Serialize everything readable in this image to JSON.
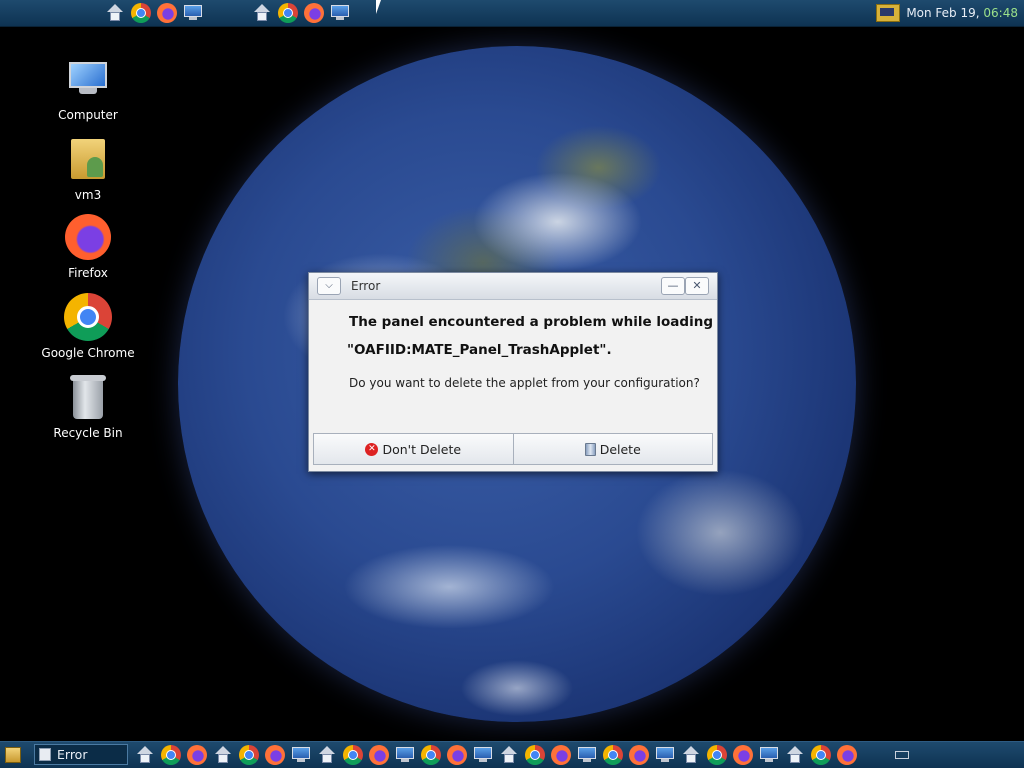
{
  "top_panel": {
    "launchers": [
      "home-icon",
      "chrome-icon",
      "firefox-icon",
      "monitor-icon",
      "home-icon",
      "chrome-icon",
      "firefox-icon",
      "monitor-icon"
    ],
    "clock": {
      "date": "Mon Feb 19,",
      "time": "06:48"
    }
  },
  "desktop": {
    "icons": [
      {
        "label": "Computer",
        "icon": "computer-icon"
      },
      {
        "label": "vm3",
        "icon": "home-folder-icon"
      },
      {
        "label": "Firefox",
        "icon": "firefox-icon"
      },
      {
        "label": "Google Chrome",
        "icon": "chrome-icon"
      },
      {
        "label": "Recycle Bin",
        "icon": "recycle-bin-icon"
      }
    ]
  },
  "dialog": {
    "title": "Error",
    "minimize_glyph": "—",
    "close_glyph": "✕",
    "heading": "The panel encountered a problem while loading",
    "applet": "\"OAFIID:MATE_Panel_TrashApplet\".",
    "question": "Do you want to delete the applet from your configuration?",
    "dont_delete_label": "Don't Delete",
    "delete_label": "Delete"
  },
  "bottom_panel": {
    "task_label": "Error",
    "launcher_pattern": [
      "home-icon",
      "chrome-icon",
      "firefox-icon",
      "home-icon",
      "chrome-icon",
      "firefox-icon",
      "monitor-icon",
      "home-icon",
      "chrome-icon",
      "firefox-icon",
      "monitor-icon",
      "chrome-icon",
      "firefox-icon",
      "monitor-icon",
      "home-icon",
      "chrome-icon",
      "firefox-icon",
      "monitor-icon",
      "chrome-icon",
      "firefox-icon",
      "monitor-icon",
      "home-icon",
      "chrome-icon",
      "firefox-icon",
      "monitor-icon",
      "home-icon",
      "chrome-icon",
      "firefox-icon"
    ]
  }
}
